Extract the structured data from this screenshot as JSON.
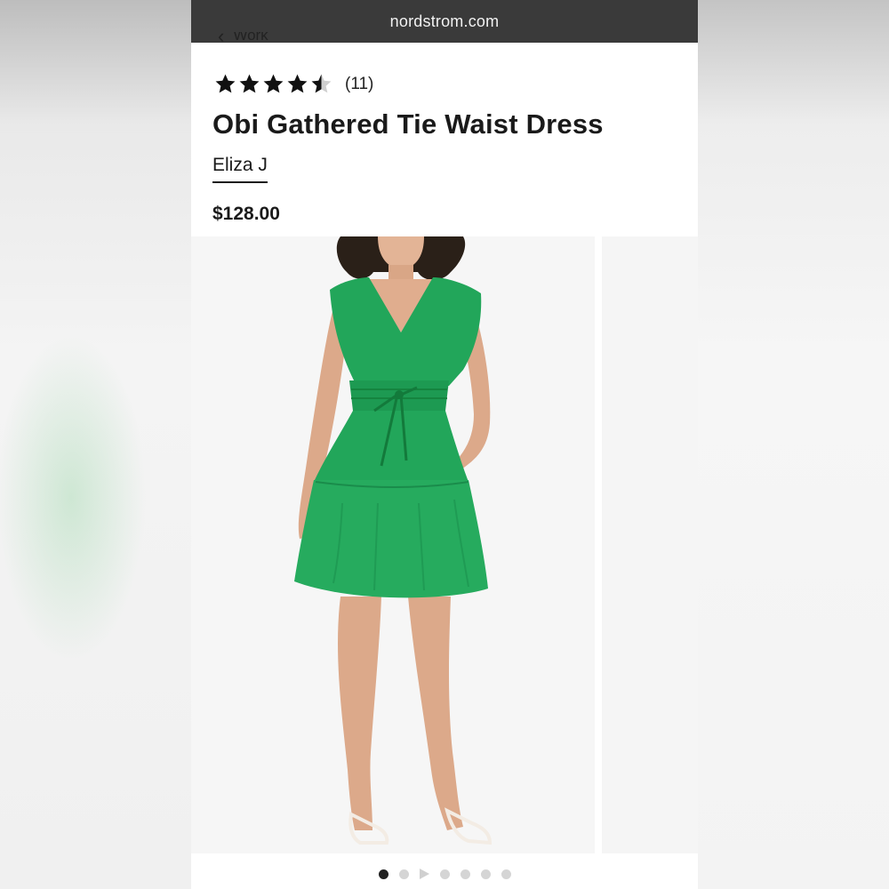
{
  "browser": {
    "url": "nordstrom.com"
  },
  "breadcrumb": {
    "back_label": "Work"
  },
  "product": {
    "rating_value": 4.5,
    "review_count": "(11)",
    "title": "Obi Gathered Tie Waist Dress",
    "brand": "Eliza J",
    "price": "$128.00"
  },
  "gallery": {
    "image_alt": "Model wearing green sleeveless v-neck tiered dress with tie waist",
    "dress_color": "#22a65a",
    "total_images": 7,
    "active_index": 0,
    "video_index": 2
  },
  "colors": {
    "urlbar": "#3a3a3a",
    "star": "#111111"
  }
}
